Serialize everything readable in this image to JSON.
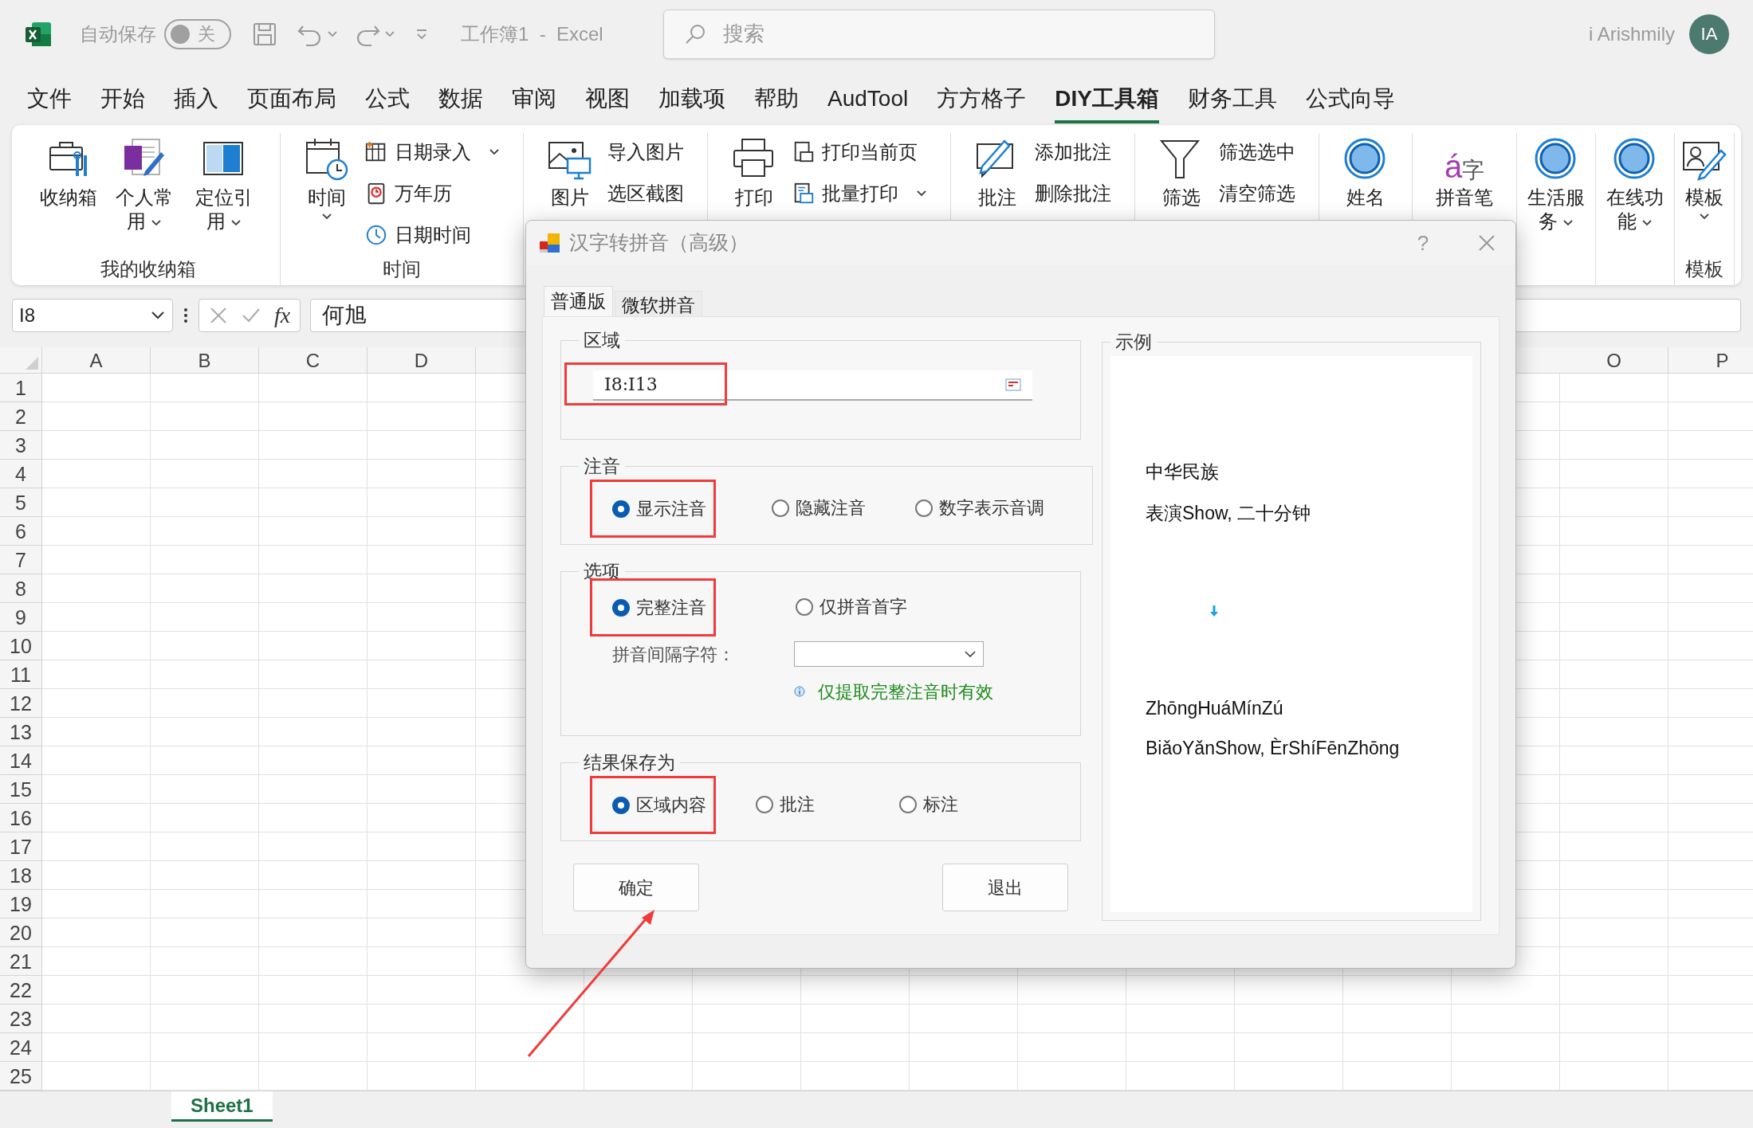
{
  "title_bar": {
    "autosave_label": "自动保存",
    "autosave": {
      "on": false,
      "label": "关"
    },
    "document_title": "工作簿1  -  Excel",
    "search": {
      "placeholder": "搜索"
    },
    "user_name": "i Arishmily",
    "avatar_initials": "IA"
  },
  "menu_tabs": [
    {
      "label": "文件",
      "selected": false
    },
    {
      "label": "开始",
      "selected": false
    },
    {
      "label": "插入",
      "selected": false
    },
    {
      "label": "页面布局",
      "selected": false
    },
    {
      "label": "公式",
      "selected": false
    },
    {
      "label": "数据",
      "selected": false
    },
    {
      "label": "审阅",
      "selected": false
    },
    {
      "label": "视图",
      "selected": false
    },
    {
      "label": "加载项",
      "selected": false
    },
    {
      "label": "帮助",
      "selected": false
    },
    {
      "label": "AudTool",
      "selected": false
    },
    {
      "label": "方方格子",
      "selected": false
    },
    {
      "label": "DIY工具箱",
      "selected": true
    },
    {
      "label": "财务工具",
      "selected": false
    },
    {
      "label": "公式向导",
      "selected": false
    }
  ],
  "ribbon": {
    "groups": [
      {
        "label": "我的收纳箱",
        "items": [
          {
            "kind": "large",
            "label": "收纳箱",
            "dropdown": false
          },
          {
            "kind": "large",
            "label": "个人常用",
            "dropdown": true
          },
          {
            "kind": "large",
            "label": "定位引用",
            "dropdown": true
          }
        ]
      },
      {
        "label": "时间",
        "items": [
          {
            "kind": "large",
            "label": "时间",
            "dropdown": true
          },
          {
            "kind": "small",
            "label": "日期录入",
            "dropdown": true
          },
          {
            "kind": "small",
            "label": "万年历",
            "dropdown": false
          },
          {
            "kind": "small",
            "label": "日期时间",
            "dropdown": false
          }
        ]
      },
      {
        "items": [
          {
            "kind": "large",
            "label": "图片",
            "dropdown": false
          },
          {
            "kind": "small",
            "label": "导入图片",
            "dropdown": false
          },
          {
            "kind": "small",
            "label": "选区截图",
            "dropdown": false
          }
        ]
      },
      {
        "items": [
          {
            "kind": "large",
            "label": "打印",
            "dropdown": false
          },
          {
            "kind": "small",
            "label": "打印当前页",
            "dropdown": false
          },
          {
            "kind": "small",
            "label": "批量打印",
            "dropdown": true
          }
        ]
      },
      {
        "items": [
          {
            "kind": "large",
            "label": "批注",
            "dropdown": false
          },
          {
            "kind": "small",
            "label": "添加批注",
            "dropdown": false
          },
          {
            "kind": "small",
            "label": "删除批注",
            "dropdown": false
          }
        ]
      },
      {
        "items": [
          {
            "kind": "large",
            "label": "筛选",
            "dropdown": false
          },
          {
            "kind": "small",
            "label": "筛选选中",
            "dropdown": false
          },
          {
            "kind": "small",
            "label": "清空筛选",
            "dropdown": false
          }
        ]
      },
      {
        "items": [
          {
            "kind": "large",
            "label": "姓名",
            "dropdown": false
          }
        ]
      },
      {
        "items": [
          {
            "kind": "large",
            "label": "拼音笔",
            "dropdown": false,
            "glyphs": [
              "á",
              "字"
            ]
          }
        ]
      },
      {
        "items": [
          {
            "kind": "large",
            "label": "生活服务",
            "dropdown": true
          }
        ]
      },
      {
        "items": [
          {
            "kind": "large",
            "label": "在线功能",
            "dropdown": true
          }
        ]
      },
      {
        "label": "模板",
        "items": [
          {
            "kind": "large",
            "label": "模板",
            "dropdown": true
          }
        ]
      }
    ]
  },
  "formula_bar": {
    "name_box": "I8",
    "fx": "fx",
    "content": "何旭"
  },
  "sheet": {
    "columns_left": [
      "A",
      "B",
      "C",
      "D"
    ],
    "columns_right": [
      "O",
      "P"
    ],
    "rows": [
      "1",
      "2",
      "3",
      "4",
      "5",
      "6",
      "7",
      "8",
      "9",
      "10",
      "11",
      "12",
      "13",
      "14",
      "15",
      "16",
      "17",
      "18",
      "19",
      "20",
      "21",
      "22",
      "23",
      "24",
      "25"
    ]
  },
  "sheet_tabs": [
    {
      "label": "Sheet1",
      "selected": true
    }
  ],
  "dialog": {
    "title": "汉字转拼音（高级）",
    "help": "?",
    "tabs": [
      {
        "label": "普通版",
        "selected": true
      },
      {
        "label": "微软拼音",
        "selected": false
      }
    ],
    "range_group": {
      "title": "区域",
      "value": "I8:I13",
      "highlighted": true
    },
    "phonetic_group": {
      "title": "注音",
      "options": [
        {
          "label": "显示注音",
          "selected": true,
          "highlighted": true
        },
        {
          "label": "隐藏注音",
          "selected": false,
          "highlighted": false
        },
        {
          "label": "数字表示音调",
          "selected": false,
          "highlighted": false
        }
      ]
    },
    "options_group": {
      "title": "选项",
      "options": [
        {
          "label": "完整注音",
          "selected": true,
          "highlighted": true
        },
        {
          "label": "仅拼音首字",
          "selected": false,
          "highlighted": false
        }
      ],
      "separator_label": "拼音间隔字符：",
      "hint": "仅提取完整注音时有效"
    },
    "save_group": {
      "title": "结果保存为",
      "options": [
        {
          "label": "区域内容",
          "selected": true,
          "highlighted": true
        },
        {
          "label": "批注",
          "selected": false,
          "highlighted": false
        },
        {
          "label": "标注",
          "selected": false,
          "highlighted": false
        }
      ]
    },
    "buttons": [
      {
        "label": "确定",
        "pointed": true
      },
      {
        "label": "退出",
        "pointed": false
      }
    ],
    "example": {
      "title": "示例",
      "source_lines": [
        "中华民族",
        "表演Show, 二十分钟"
      ],
      "result_lines": [
        "ZhōngHuáMínZú",
        "BiǎoYǎnShow, ÈrShíFēnZhōng"
      ]
    }
  }
}
